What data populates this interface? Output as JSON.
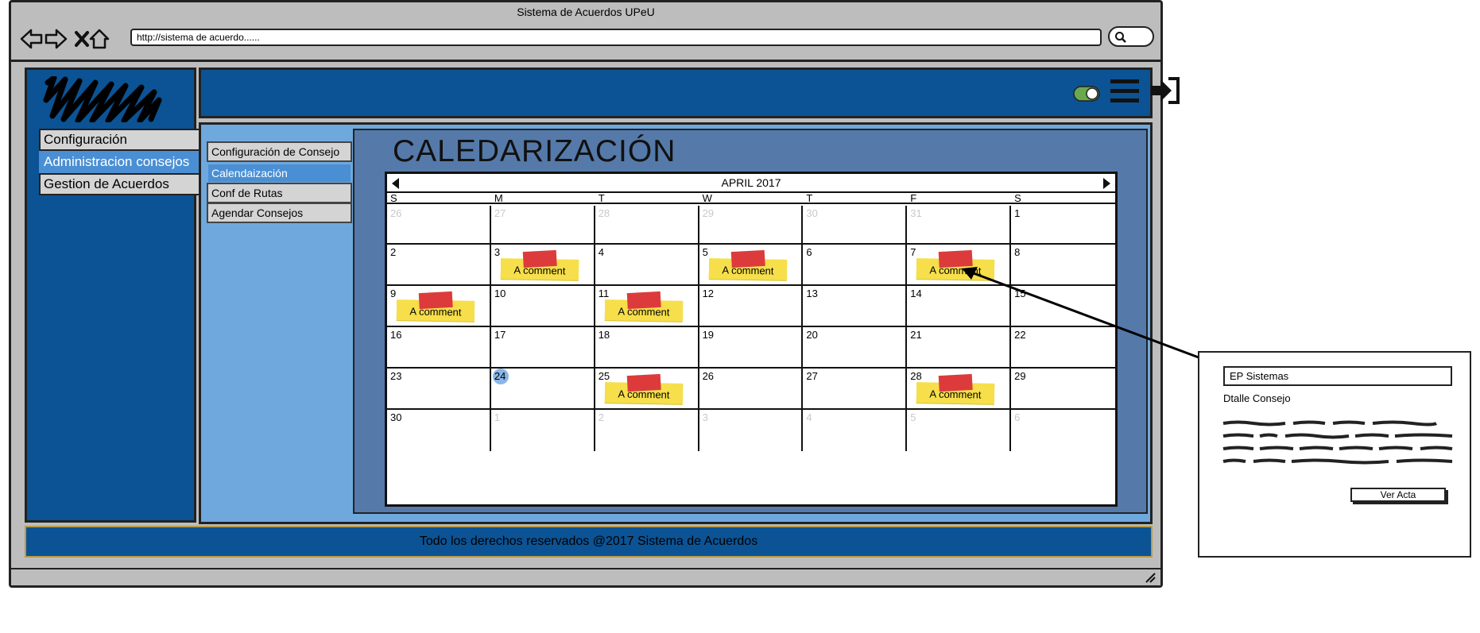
{
  "window": {
    "title": "Sistema de Acuerdos UPeU"
  },
  "browser": {
    "url": "http://sistema de acuerdo......",
    "icons": [
      "back-arrow-icon",
      "forward-arrow-icon",
      "close-x-icon",
      "home-icon",
      "search-icon"
    ]
  },
  "header": {
    "icons": [
      "toggle-switch-icon",
      "hamburger-menu-icon",
      "logout-icon"
    ]
  },
  "sidebar": {
    "logo": "scribble-logo",
    "items": [
      {
        "label": "Configuración",
        "active": false
      },
      {
        "label": "Administracion consejos",
        "active": true
      },
      {
        "label": "Gestion de Acuerdos",
        "active": false
      }
    ]
  },
  "submenu": {
    "items": [
      {
        "label": "Configuración de Consejo",
        "active": false
      },
      {
        "label": "Calendaización",
        "active": true
      },
      {
        "label": "Conf de Rutas",
        "active": false
      },
      {
        "label": "Agendar Consejos",
        "active": false
      }
    ]
  },
  "calendar": {
    "title": "CALEDARIZACIÓN",
    "month": "APRIL 2017",
    "weekdays": [
      "S",
      "M",
      "T",
      "W",
      "T",
      "F",
      "S"
    ],
    "weeks": [
      [
        {
          "d": "26",
          "muted": true
        },
        {
          "d": "27",
          "muted": true
        },
        {
          "d": "28",
          "muted": true
        },
        {
          "d": "29",
          "muted": true
        },
        {
          "d": "30",
          "muted": true
        },
        {
          "d": "31",
          "muted": true
        },
        {
          "d": "1"
        }
      ],
      [
        {
          "d": "2"
        },
        {
          "d": "3",
          "note": "A comment"
        },
        {
          "d": "4"
        },
        {
          "d": "5",
          "note": "A comment"
        },
        {
          "d": "6"
        },
        {
          "d": "7",
          "note": "A comment"
        },
        {
          "d": "8"
        }
      ],
      [
        {
          "d": "9",
          "note": "A comment"
        },
        {
          "d": "10"
        },
        {
          "d": "11",
          "note": "A comment"
        },
        {
          "d": "12"
        },
        {
          "d": "13"
        },
        {
          "d": "14"
        },
        {
          "d": "15"
        }
      ],
      [
        {
          "d": "16"
        },
        {
          "d": "17"
        },
        {
          "d": "18"
        },
        {
          "d": "19"
        },
        {
          "d": "20"
        },
        {
          "d": "21"
        },
        {
          "d": "22"
        }
      ],
      [
        {
          "d": "23"
        },
        {
          "d": "24",
          "today": true
        },
        {
          "d": "25",
          "note": "A comment"
        },
        {
          "d": "26"
        },
        {
          "d": "27"
        },
        {
          "d": "28",
          "note": "A comment"
        },
        {
          "d": "29"
        }
      ],
      [
        {
          "d": "30"
        },
        {
          "d": "1",
          "muted": true
        },
        {
          "d": "2",
          "muted": true
        },
        {
          "d": "3",
          "muted": true
        },
        {
          "d": "4",
          "muted": true
        },
        {
          "d": "5",
          "muted": true
        },
        {
          "d": "6",
          "muted": true
        }
      ]
    ]
  },
  "footer": {
    "text": "Todo los derechos reservados @2017 Sistema de Acuerdos"
  },
  "popup": {
    "field_value": "EP Sistemas",
    "label": "Dtalle Consejo",
    "button_label": "Ver Acta"
  },
  "colors": {
    "sidebar": "#0b5394",
    "content": "#6fa8dc",
    "calendar_panel": "#557aa9",
    "note": "#f6df4a",
    "tape": "#dd3b3b",
    "active": "#4a8fd4"
  }
}
